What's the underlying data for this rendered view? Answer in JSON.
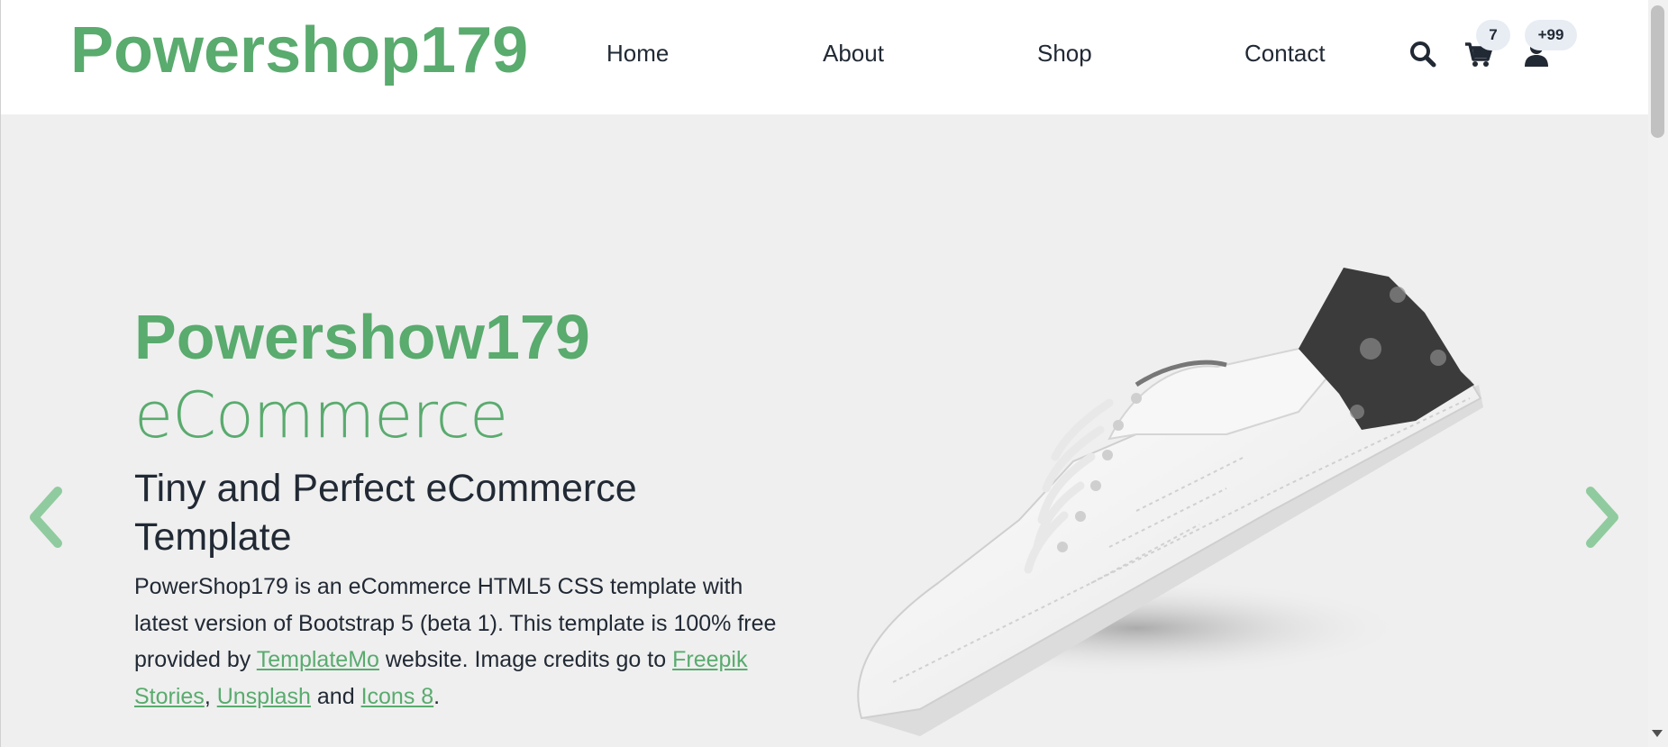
{
  "header": {
    "brand": "Powershop179",
    "nav": [
      "Home",
      "About",
      "Shop",
      "Contact"
    ],
    "icons": [
      "search-icon",
      "cart-icon",
      "user-icon"
    ],
    "cart_count": "7",
    "user_count": "+99"
  },
  "hero": {
    "title": "Powershow179",
    "subtitle": "eCommerce",
    "heading": "Tiny and Perfect eCommerce Template",
    "paragraph": {
      "text_1": "PowerShop179 is an eCommerce HTML5 CSS template with latest version of Bootstrap 5 (beta 1). This template is 100% free provided by ",
      "link_1": "TemplateMo",
      "text_2": " website. Image credits go to ",
      "link_2": "Freepik Stories",
      "sep_1": ", ",
      "link_3": "Unsplash",
      "text_3": " and ",
      "link_4": "Icons 8",
      "text_4": "."
    },
    "image": "white-sneaker-with-dark-heel"
  },
  "colors": {
    "accent": "#59ab6e",
    "text": "#212934",
    "hero_bg": "#efefef"
  }
}
